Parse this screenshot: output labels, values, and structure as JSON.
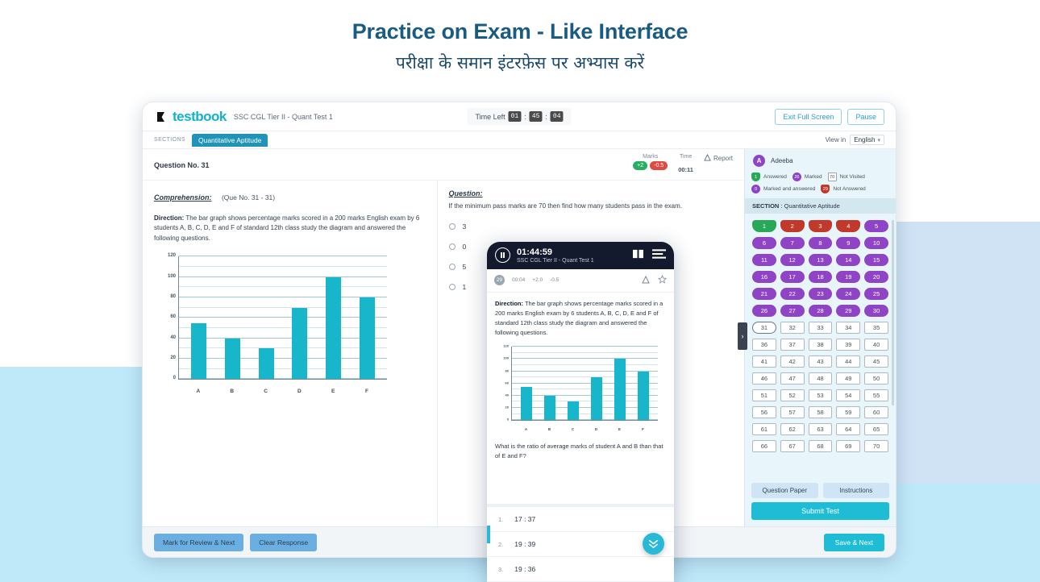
{
  "page": {
    "headline": "Practice on Exam - Like Interface",
    "subheadline": "परीक्षा के समान इंटरफ़ेस पर अभ्यास करें",
    "accent_color": "#1fbcd6",
    "headline_color": "#1a5b81",
    "bg_wave_color": "#bfe9f9"
  },
  "topbar": {
    "brand_name": "testbook",
    "brand_icon": "bookmark-icon",
    "test_name": "SSC CGL Tier II - Quant Test 1",
    "time_left_label": "Time Left",
    "time_hours": "01",
    "time_minutes": "45",
    "time_seconds": "04",
    "separator": ":",
    "exit_full_screen_label": "Exit Full Screen",
    "pause_label": "Pause"
  },
  "sections": {
    "label": "SECTIONS",
    "active_tab": "Quantitative Aptitude",
    "view_in_label": "View in",
    "view_in_value": "English"
  },
  "question_header": {
    "question_no": "Question No. 31",
    "marks_label": "Marks",
    "marks_positive": "+2",
    "marks_negative": "-0.5",
    "time_label": "Time",
    "time_value": "00:11",
    "report_label": "Report",
    "report_icon": "warning-triangle-icon"
  },
  "comprehension": {
    "label": "Comprehension:",
    "range": "(Que No. 31 - 31)",
    "direction_bold": "Direction:",
    "direction_text": " The bar graph shows percentage marks scored in a 200 marks English exam by 6 students A, B, C, D, E and F of standard 12th class study the diagram and answered the following questions."
  },
  "question": {
    "label": "Question:",
    "text": "If the minimum pass marks are 70 then find how many students pass in the exam.",
    "options": [
      "3",
      "0",
      "5",
      "1"
    ]
  },
  "chart_data": {
    "type": "bar",
    "categories": [
      "A",
      "B",
      "C",
      "D",
      "E",
      "F"
    ],
    "values": [
      55,
      40,
      30,
      70,
      100,
      80
    ],
    "title": "",
    "xlabel": "",
    "ylabel": "",
    "ylim": [
      0,
      120
    ],
    "yticks": [
      0,
      20,
      40,
      60,
      80,
      100,
      120
    ],
    "minor_gridline_step": 10,
    "grid": true,
    "legend": "none",
    "bar_color": "#18b6cb"
  },
  "sidebar": {
    "user_initial": "A",
    "user_name": "Adeeba",
    "legend": [
      {
        "count": "1",
        "label": "Answered",
        "state": "answered"
      },
      {
        "count": "26",
        "label": "Marked",
        "state": "marked"
      },
      {
        "count": "70",
        "label": "Not Visited",
        "state": "notvisited"
      },
      {
        "count": "0",
        "label": "Marked and answered",
        "state": "markans"
      },
      {
        "count": "29",
        "label": "Not Answered",
        "state": "notans"
      }
    ],
    "section_prefix": "SECTION",
    "section_sep": " : ",
    "section_name": "Quantitative Aptitude",
    "palette": [
      {
        "n": "1",
        "state": "answered"
      },
      {
        "n": "2",
        "state": "notans"
      },
      {
        "n": "3",
        "state": "notans"
      },
      {
        "n": "4",
        "state": "notans"
      },
      {
        "n": "5",
        "state": "marked"
      },
      {
        "n": "6",
        "state": "marked"
      },
      {
        "n": "7",
        "state": "marked"
      },
      {
        "n": "8",
        "state": "marked"
      },
      {
        "n": "9",
        "state": "marked"
      },
      {
        "n": "10",
        "state": "marked"
      },
      {
        "n": "11",
        "state": "marked"
      },
      {
        "n": "12",
        "state": "marked"
      },
      {
        "n": "13",
        "state": "marked"
      },
      {
        "n": "14",
        "state": "marked"
      },
      {
        "n": "15",
        "state": "marked"
      },
      {
        "n": "16",
        "state": "marked"
      },
      {
        "n": "17",
        "state": "marked"
      },
      {
        "n": "18",
        "state": "marked"
      },
      {
        "n": "19",
        "state": "marked"
      },
      {
        "n": "20",
        "state": "marked"
      },
      {
        "n": "21",
        "state": "marked"
      },
      {
        "n": "22",
        "state": "marked"
      },
      {
        "n": "23",
        "state": "marked"
      },
      {
        "n": "24",
        "state": "marked"
      },
      {
        "n": "25",
        "state": "marked"
      },
      {
        "n": "26",
        "state": "marked"
      },
      {
        "n": "27",
        "state": "marked"
      },
      {
        "n": "28",
        "state": "marked"
      },
      {
        "n": "29",
        "state": "marked"
      },
      {
        "n": "30",
        "state": "marked"
      },
      {
        "n": "31",
        "state": "current"
      },
      {
        "n": "32",
        "state": "notvisited"
      },
      {
        "n": "33",
        "state": "notvisited"
      },
      {
        "n": "34",
        "state": "notvisited"
      },
      {
        "n": "35",
        "state": "notvisited"
      },
      {
        "n": "36",
        "state": "notvisited"
      },
      {
        "n": "37",
        "state": "notvisited"
      },
      {
        "n": "38",
        "state": "notvisited"
      },
      {
        "n": "39",
        "state": "notvisited"
      },
      {
        "n": "40",
        "state": "notvisited"
      },
      {
        "n": "41",
        "state": "notvisited"
      },
      {
        "n": "42",
        "state": "notvisited"
      },
      {
        "n": "43",
        "state": "notvisited"
      },
      {
        "n": "44",
        "state": "notvisited"
      },
      {
        "n": "45",
        "state": "notvisited"
      },
      {
        "n": "46",
        "state": "notvisited"
      },
      {
        "n": "47",
        "state": "notvisited"
      },
      {
        "n": "48",
        "state": "notvisited"
      },
      {
        "n": "49",
        "state": "notvisited"
      },
      {
        "n": "50",
        "state": "notvisited"
      },
      {
        "n": "51",
        "state": "notvisited"
      },
      {
        "n": "52",
        "state": "notvisited"
      },
      {
        "n": "53",
        "state": "notvisited"
      },
      {
        "n": "54",
        "state": "notvisited"
      },
      {
        "n": "55",
        "state": "notvisited"
      },
      {
        "n": "56",
        "state": "notvisited"
      },
      {
        "n": "57",
        "state": "notvisited"
      },
      {
        "n": "58",
        "state": "notvisited"
      },
      {
        "n": "59",
        "state": "notvisited"
      },
      {
        "n": "60",
        "state": "notvisited"
      },
      {
        "n": "61",
        "state": "notvisited"
      },
      {
        "n": "62",
        "state": "notvisited"
      },
      {
        "n": "63",
        "state": "notvisited"
      },
      {
        "n": "64",
        "state": "notvisited"
      },
      {
        "n": "65",
        "state": "notvisited"
      },
      {
        "n": "66",
        "state": "notvisited"
      },
      {
        "n": "67",
        "state": "notvisited"
      },
      {
        "n": "68",
        "state": "notvisited"
      },
      {
        "n": "69",
        "state": "notvisited"
      },
      {
        "n": "70",
        "state": "notvisited"
      }
    ],
    "question_paper_label": "Question Paper",
    "instructions_label": "Instructions",
    "submit_label": "Submit Test",
    "collapse_icon": "chevron-right-icon"
  },
  "footer": {
    "mark_review_label": "Mark for Review & Next",
    "clear_response_label": "Clear Response",
    "save_next_label": "Save & Next"
  },
  "mobile": {
    "pause_icon": "pause-icon",
    "time": "01:44:59",
    "test_name": "SSC CGL Tier II - Quant Test 1",
    "book_icon": "book-icon",
    "menu_icon": "hamburger-menu-icon",
    "question_badge": "29",
    "elapsed": "00:04",
    "marks_positive": "+2.0",
    "marks_negative": "-0.5",
    "report_icon": "warning-triangle-icon",
    "bookmark_icon": "star-icon",
    "direction_bold": "Direction:",
    "direction_text": " The bar graph shows percentage marks scored in a 200 marks English exam by 6 students A, B, C, D, E and F of standard 12th class study the diagram and answered the following questions.",
    "question_text": "What is the ratio of average marks of student A and B than that of E and F?",
    "options": [
      {
        "n": "1.",
        "text": "17 : 37"
      },
      {
        "n": "2.",
        "text": "19 : 39"
      },
      {
        "n": "3.",
        "text": "19 : 36"
      }
    ],
    "fab_icon": "double-chevron-down-icon"
  }
}
